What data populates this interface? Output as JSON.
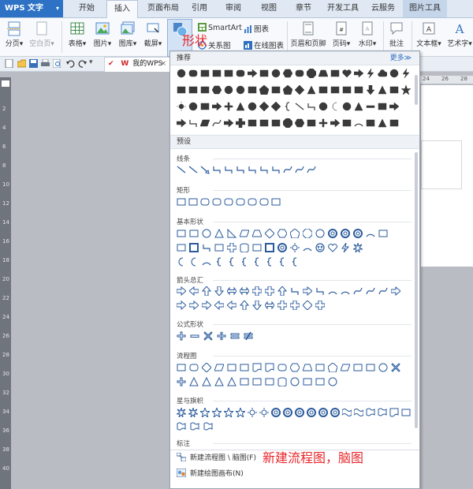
{
  "app": {
    "name": "WPS 文字"
  },
  "tabs": [
    {
      "label": "开始",
      "active": false
    },
    {
      "label": "插入",
      "active": true
    },
    {
      "label": "页面布局",
      "active": false
    },
    {
      "label": "引用",
      "active": false
    },
    {
      "label": "审阅",
      "active": false
    },
    {
      "label": "视图",
      "active": false
    },
    {
      "label": "章节",
      "active": false
    },
    {
      "label": "开发工具",
      "active": false
    },
    {
      "label": "云服务",
      "active": false
    },
    {
      "label": "图片工具",
      "active": false
    }
  ],
  "ribbon": {
    "page_break": "分页",
    "blank_page": "空白页",
    "table": "表格",
    "picture": "图片",
    "gallery": "图库",
    "screenshot": "截屏",
    "shape": "形状",
    "smartart": "SmartArt",
    "chart": "图表",
    "relation": "关系图",
    "online_chart": "在线图表",
    "header_footer": "页眉和页脚",
    "page_number": "页码",
    "watermark": "水印",
    "comment": "批注",
    "textbox": "文本框",
    "wordart": "艺术字"
  },
  "doc_tab": {
    "label": "我的WPS",
    "close": "×"
  },
  "panel": {
    "recommended_title": "推荐",
    "more_link": "更多≫",
    "preset_title": "预设",
    "categories": [
      {
        "name": "线条"
      },
      {
        "name": "矩形"
      },
      {
        "name": "基本形状"
      },
      {
        "name": "箭头总汇"
      },
      {
        "name": "公式形状"
      },
      {
        "name": "流程图"
      },
      {
        "name": "星与旗帜"
      },
      {
        "name": "标注"
      }
    ],
    "bottom_items": [
      {
        "label": "新建流程图 \\ 脑图(F)"
      },
      {
        "label": "新建绘图画布(N)"
      }
    ]
  },
  "annotations": {
    "shape": "形状",
    "new_flow": "新建流程图，脑图"
  },
  "ruler": {
    "top_numbers": [
      "24",
      "26",
      "28"
    ],
    "left_numbers": [
      "2",
      "4",
      "6",
      "8",
      "10",
      "12",
      "14",
      "16",
      "18",
      "20",
      "22",
      "24",
      "26",
      "28",
      "30",
      "32",
      "34",
      "36",
      "38",
      "40"
    ]
  },
  "colors": {
    "accent": "#2d72c4",
    "annotation": "#e8262b",
    "shape_fill": "#3a3a3a",
    "shape_outline": "#2a5a9c"
  }
}
